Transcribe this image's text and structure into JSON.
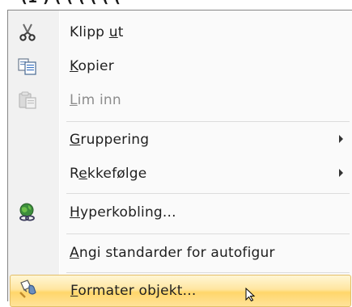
{
  "top_sliver_text": "(1 ) ( ( ( ( ( (",
  "menu": {
    "items": [
      {
        "pre": "Klipp ",
        "u": "u",
        "post": "t",
        "icon": "scissors-icon",
        "disabled": false,
        "submenu": false
      },
      {
        "pre": "",
        "u": "K",
        "post": "opier",
        "icon": "copy-icon",
        "disabled": false,
        "submenu": false
      },
      {
        "pre": "",
        "u": "L",
        "post": "im inn",
        "icon": "paste-icon",
        "disabled": true,
        "submenu": false
      },
      {
        "pre": "",
        "u": "G",
        "post": "ruppering",
        "icon": "",
        "disabled": false,
        "submenu": true
      },
      {
        "pre": "R",
        "u": "e",
        "post": "kkefølge",
        "icon": "",
        "disabled": false,
        "submenu": true
      },
      {
        "pre": "",
        "u": "H",
        "post": "yperkobling...",
        "icon": "hyperlink-globe-icon",
        "disabled": false,
        "submenu": false
      },
      {
        "pre": "",
        "u": "A",
        "post": "ngi standarder for autofigur",
        "icon": "",
        "disabled": false,
        "submenu": false
      },
      {
        "pre": "",
        "u": "F",
        "post": "ormater objekt...",
        "icon": "format-object-icon",
        "disabled": false,
        "submenu": false,
        "hover": true
      }
    ]
  },
  "colors": {
    "hover_top": "#fff6d5",
    "hover_bottom": "#ffd66b",
    "hover_border": "#e3be67",
    "disabled_text": "#8d8d8d"
  }
}
